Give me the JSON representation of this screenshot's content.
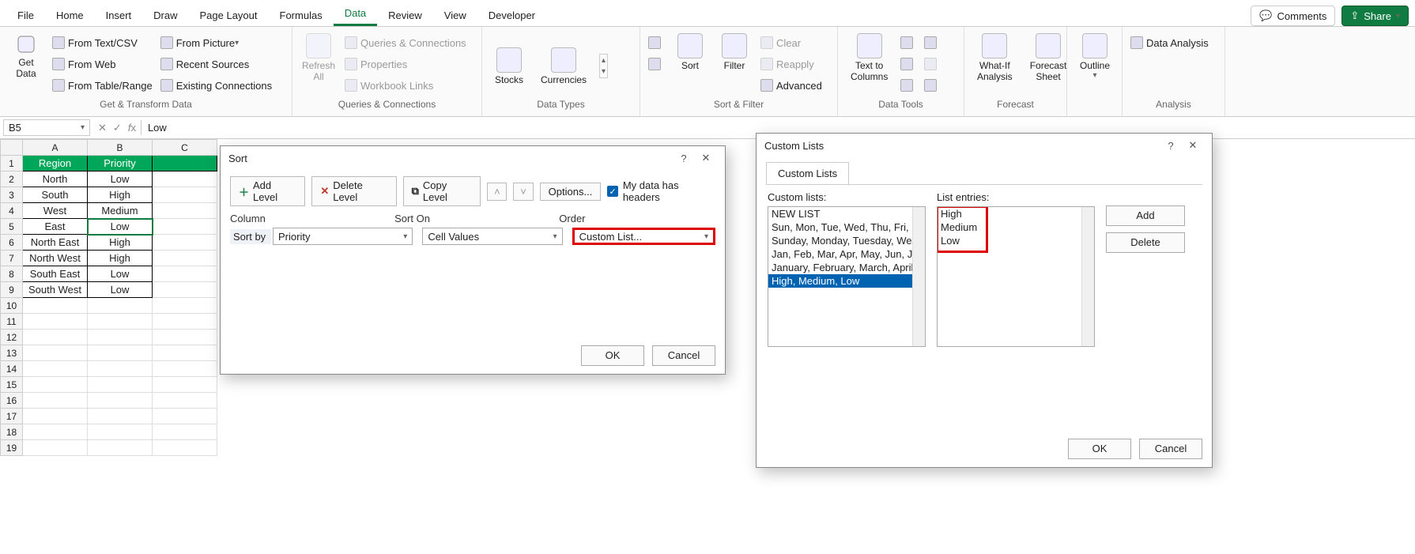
{
  "menu": {
    "items": [
      "File",
      "Home",
      "Insert",
      "Draw",
      "Page Layout",
      "Formulas",
      "Data",
      "Review",
      "View",
      "Developer"
    ],
    "active": "Data",
    "comments": "Comments",
    "share": "Share"
  },
  "ribbon": {
    "get_data": {
      "label": "Get\nData",
      "items": [
        "From Text/CSV",
        "From Web",
        "From Table/Range",
        "From Picture",
        "Recent Sources",
        "Existing Connections"
      ],
      "group": "Get & Transform Data"
    },
    "queries": {
      "refresh": "Refresh\nAll",
      "items": [
        "Queries & Connections",
        "Properties",
        "Workbook Links"
      ],
      "group": "Queries & Connections"
    },
    "types": {
      "stocks": "Stocks",
      "currencies": "Currencies",
      "group": "Data Types"
    },
    "sortfilter": {
      "sort": "Sort",
      "filter": "Filter",
      "clear": "Clear",
      "reapply": "Reapply",
      "advanced": "Advanced",
      "group": "Sort & Filter"
    },
    "tools": {
      "t2c": "Text to\nColumns",
      "group": "Data Tools"
    },
    "forecast": {
      "whatif": "What-If\nAnalysis",
      "sheet": "Forecast\nSheet",
      "group": "Forecast"
    },
    "outline": {
      "label": "Outline",
      "group": ""
    },
    "analysis": {
      "da": "Data Analysis",
      "group": "Analysis"
    }
  },
  "fx": {
    "name_box": "B5",
    "value": "Low"
  },
  "sheet": {
    "cols": [
      "A",
      "B",
      "C"
    ],
    "rows": [
      {
        "n": 1,
        "a": "Region",
        "b": "Priority",
        "hdr": true
      },
      {
        "n": 2,
        "a": "North",
        "b": "Low"
      },
      {
        "n": 3,
        "a": "South",
        "b": "High"
      },
      {
        "n": 4,
        "a": "West",
        "b": "Medium"
      },
      {
        "n": 5,
        "a": "East",
        "b": "Low",
        "sel": "b"
      },
      {
        "n": 6,
        "a": "North East",
        "b": "High"
      },
      {
        "n": 7,
        "a": "North West",
        "b": "High"
      },
      {
        "n": 8,
        "a": "South East",
        "b": "Low"
      },
      {
        "n": 9,
        "a": "South West",
        "b": "Low"
      }
    ],
    "empty_rows": [
      10,
      11,
      12,
      13,
      14,
      15,
      16,
      17,
      18,
      19
    ]
  },
  "sort_dialog": {
    "title": "Sort",
    "add": "Add Level",
    "del": "Delete Level",
    "copy": "Copy Level",
    "options": "Options...",
    "headers_chk": "My data has headers",
    "col_hdr": "Column",
    "sorton_hdr": "Sort On",
    "order_hdr": "Order",
    "sortby": "Sort by",
    "field": "Priority",
    "sorton": "Cell Values",
    "order": "Custom List...",
    "ok": "OK",
    "cancel": "Cancel"
  },
  "custom_dialog": {
    "title": "Custom Lists",
    "tab": "Custom Lists",
    "lists_label": "Custom lists:",
    "entries_label": "List entries:",
    "lists": [
      {
        "t": "NEW LIST"
      },
      {
        "t": "Sun, Mon, Tue, Wed, Thu, Fri, Sat"
      },
      {
        "t": "Sunday, Monday, Tuesday, Wednes"
      },
      {
        "t": "Jan, Feb, Mar, Apr, May, Jun, Jul, Au"
      },
      {
        "t": "January, February, March, April, Ma"
      },
      {
        "t": "High, Medium, Low",
        "sel": true
      }
    ],
    "entries": [
      "High",
      "Medium",
      "Low"
    ],
    "add": "Add",
    "delete": "Delete",
    "ok": "OK",
    "cancel": "Cancel"
  }
}
